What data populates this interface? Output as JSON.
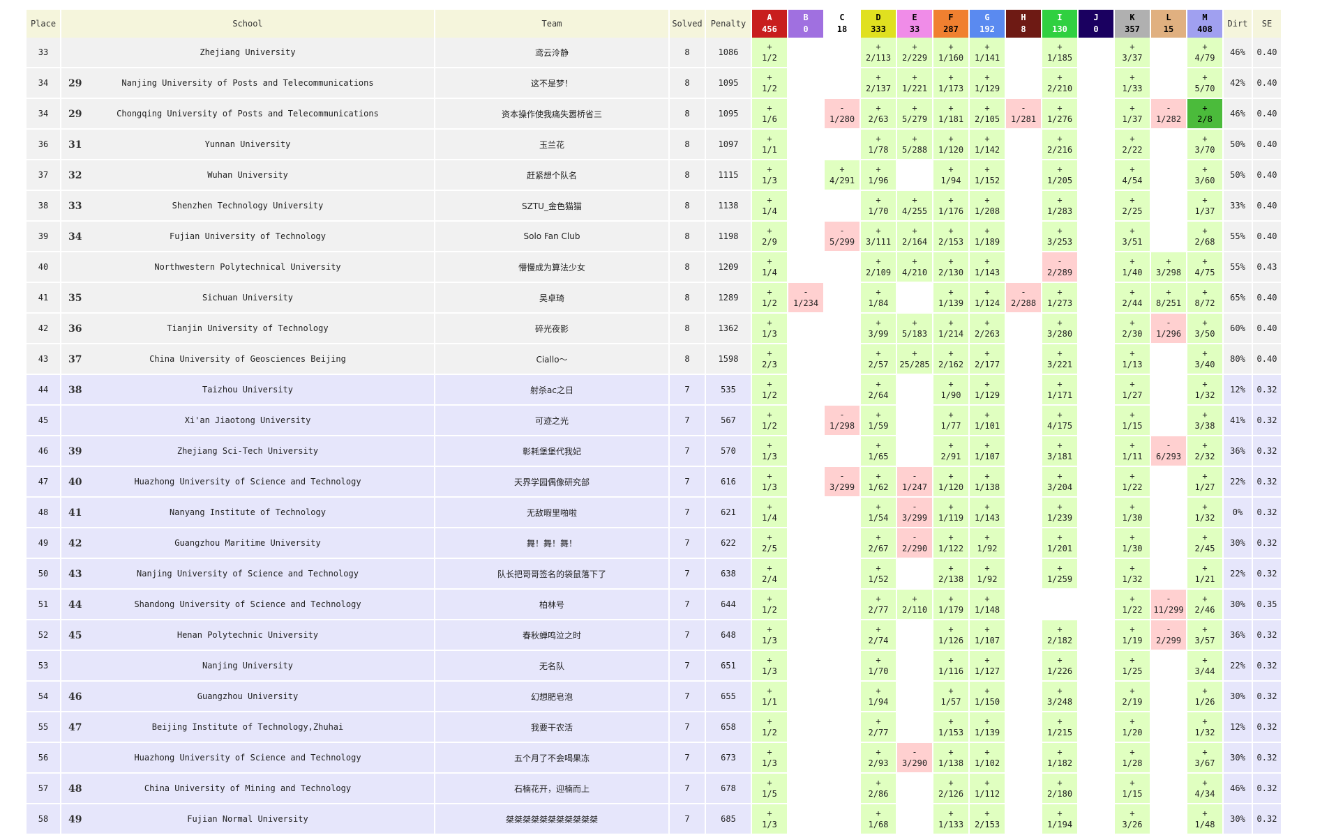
{
  "headers": {
    "place": "Place",
    "school": "School",
    "team": "Team",
    "solved": "Solved",
    "penalty": "Penalty",
    "dirt": "Dirt",
    "se": "SE"
  },
  "problems": [
    {
      "letter": "A",
      "count": "456",
      "bg": "#c81e1e",
      "fg": "#ffffff"
    },
    {
      "letter": "B",
      "count": "0",
      "bg": "#a070e0",
      "fg": "#ffffff"
    },
    {
      "letter": "C",
      "count": "18",
      "bg": "#ffffff",
      "fg": "#000000"
    },
    {
      "letter": "D",
      "count": "333",
      "bg": "#e0e020",
      "fg": "#000000"
    },
    {
      "letter": "E",
      "count": "33",
      "bg": "#f08ce8",
      "fg": "#000000"
    },
    {
      "letter": "F",
      "count": "287",
      "bg": "#f08030",
      "fg": "#000000"
    },
    {
      "letter": "G",
      "count": "192",
      "bg": "#5a8af0",
      "fg": "#ffffff"
    },
    {
      "letter": "H",
      "count": "8",
      "bg": "#6e1a14",
      "fg": "#ffffff"
    },
    {
      "letter": "I",
      "count": "130",
      "bg": "#30d040",
      "fg": "#ffffff"
    },
    {
      "letter": "J",
      "count": "0",
      "bg": "#1a0060",
      "fg": "#ffffff"
    },
    {
      "letter": "K",
      "count": "357",
      "bg": "#b0b0b0",
      "fg": "#000000"
    },
    {
      "letter": "L",
      "count": "15",
      "bg": "#e0b080",
      "fg": "#000000"
    },
    {
      "letter": "M",
      "count": "408",
      "bg": "#a0a0f0",
      "fg": "#000000"
    }
  ],
  "rows": [
    {
      "place": "33",
      "srank": "",
      "school": "Zhejiang University",
      "team": "鸢云泠静",
      "solved": "8",
      "penalty": "1086",
      "dirt": "46%",
      "se": "0.40",
      "group": 8,
      "cells": [
        "+|1/2",
        "",
        "",
        "+|2/113",
        "+|2/229",
        "+|1/160",
        "+|1/141",
        "",
        "+|1/185",
        "",
        "+|3/37",
        "",
        "+|4/79"
      ]
    },
    {
      "place": "34",
      "srank": "29",
      "school": "Nanjing University of Posts and Telecommunications",
      "team": "这不是梦！",
      "solved": "8",
      "penalty": "1095",
      "dirt": "42%",
      "se": "0.40",
      "group": 8,
      "cells": [
        "+|1/2",
        "",
        "",
        "+|2/137",
        "+|1/221",
        "+|1/173",
        "+|1/129",
        "",
        "+|2/210",
        "",
        "+|1/33",
        "",
        "+|5/70"
      ]
    },
    {
      "place": "34",
      "srank": "29",
      "school": "Chongqing University of Posts and Telecommunications",
      "team": "资本操作使我痛失嚣桥省三",
      "solved": "8",
      "penalty": "1095",
      "dirt": "46%",
      "se": "0.40",
      "group": 8,
      "cells": [
        "+|1/6",
        "",
        "-|1/280",
        "+|2/63",
        "+|5/279",
        "+|1/181",
        "+|2/105",
        "-|1/281",
        "+|1/276",
        "",
        "+|1/37",
        "-|1/282",
        "*|2/8"
      ]
    },
    {
      "place": "36",
      "srank": "31",
      "school": "Yunnan University",
      "team": "玉兰花",
      "solved": "8",
      "penalty": "1097",
      "dirt": "50%",
      "se": "0.40",
      "group": 8,
      "cells": [
        "+|1/1",
        "",
        "",
        "+|1/78",
        "+|5/288",
        "+|1/120",
        "+|1/142",
        "",
        "+|2/216",
        "",
        "+|2/22",
        "",
        "+|3/70"
      ]
    },
    {
      "place": "37",
      "srank": "32",
      "school": "Wuhan University",
      "team": "赶紧想个队名",
      "solved": "8",
      "penalty": "1115",
      "dirt": "50%",
      "se": "0.40",
      "group": 8,
      "cells": [
        "+|1/3",
        "",
        "+|4/291",
        "+|1/96",
        "",
        "+|1/94",
        "+|1/152",
        "",
        "+|1/205",
        "",
        "+|4/54",
        "",
        "+|3/60"
      ]
    },
    {
      "place": "38",
      "srank": "33",
      "school": "Shenzhen Technology University",
      "team": "SZTU_金色猫猫",
      "solved": "8",
      "penalty": "1138",
      "dirt": "33%",
      "se": "0.40",
      "group": 8,
      "cells": [
        "+|1/4",
        "",
        "",
        "+|1/70",
        "+|4/255",
        "+|1/176",
        "+|1/208",
        "",
        "+|1/283",
        "",
        "+|2/25",
        "",
        "+|1/37"
      ]
    },
    {
      "place": "39",
      "srank": "34",
      "school": "Fujian University of Technology",
      "team": "Solo Fan Club",
      "solved": "8",
      "penalty": "1198",
      "dirt": "55%",
      "se": "0.40",
      "group": 8,
      "cells": [
        "+|2/9",
        "",
        "-|5/299",
        "+|3/111",
        "+|2/164",
        "+|2/153",
        "+|1/189",
        "",
        "+|3/253",
        "",
        "+|3/51",
        "",
        "+|2/68"
      ]
    },
    {
      "place": "40",
      "srank": "",
      "school": "Northwestern Polytechnical University",
      "team": "懵慢成为算法少女",
      "solved": "8",
      "penalty": "1209",
      "dirt": "55%",
      "se": "0.43",
      "group": 8,
      "cells": [
        "+|1/4",
        "",
        "",
        "+|2/109",
        "+|4/210",
        "+|2/130",
        "+|1/143",
        "",
        "-|2/289",
        "",
        "+|1/40",
        "+|3/298",
        "+|4/75"
      ]
    },
    {
      "place": "41",
      "srank": "35",
      "school": "Sichuan University",
      "team": "吴卓琦",
      "solved": "8",
      "penalty": "1289",
      "dirt": "65%",
      "se": "0.40",
      "group": 8,
      "cells": [
        "+|1/2",
        "-|1/234",
        "",
        "+|1/84",
        "",
        "+|1/139",
        "+|1/124",
        "-|2/288",
        "+|1/273",
        "",
        "+|2/44",
        "+|8/251",
        "+|8/72"
      ]
    },
    {
      "place": "42",
      "srank": "36",
      "school": "Tianjin University of Technology",
      "team": "碎光夜影",
      "solved": "8",
      "penalty": "1362",
      "dirt": "60%",
      "se": "0.40",
      "group": 8,
      "cells": [
        "+|1/3",
        "",
        "",
        "+|3/99",
        "+|5/183",
        "+|1/214",
        "+|2/263",
        "",
        "+|3/280",
        "",
        "+|2/30",
        "-|1/296",
        "+|3/50"
      ]
    },
    {
      "place": "43",
      "srank": "37",
      "school": "China University of Geosciences Beijing",
      "team": "Ciallo～",
      "solved": "8",
      "penalty": "1598",
      "dirt": "80%",
      "se": "0.40",
      "group": 8,
      "cells": [
        "+|2/3",
        "",
        "",
        "+|2/57",
        "+|25/285",
        "+|2/162",
        "+|2/177",
        "",
        "+|3/221",
        "",
        "+|1/13",
        "",
        "+|3/40"
      ]
    },
    {
      "place": "44",
      "srank": "38",
      "school": "Taizhou University",
      "team": "射杀ac之日",
      "solved": "7",
      "penalty": "535",
      "dirt": "12%",
      "se": "0.32",
      "group": 7,
      "cells": [
        "+|1/2",
        "",
        "",
        "+|2/64",
        "",
        "+|1/90",
        "+|1/129",
        "",
        "+|1/171",
        "",
        "+|1/27",
        "",
        "+|1/32"
      ]
    },
    {
      "place": "45",
      "srank": "",
      "school": "Xi'an Jiaotong University",
      "team": "可迹之光",
      "solved": "7",
      "penalty": "567",
      "dirt": "41%",
      "se": "0.32",
      "group": 7,
      "cells": [
        "+|1/2",
        "",
        "-|1/298",
        "+|1/59",
        "",
        "+|1/77",
        "+|1/101",
        "",
        "+|4/175",
        "",
        "+|1/15",
        "",
        "+|3/38"
      ]
    },
    {
      "place": "46",
      "srank": "39",
      "school": "Zhejiang Sci-Tech University",
      "team": "彰耗堡堡代我妃",
      "solved": "7",
      "penalty": "570",
      "dirt": "36%",
      "se": "0.32",
      "group": 7,
      "cells": [
        "+|1/3",
        "",
        "",
        "+|1/65",
        "",
        "+|2/91",
        "+|1/107",
        "",
        "+|3/181",
        "",
        "+|1/11",
        "-|6/293",
        "+|2/32"
      ]
    },
    {
      "place": "47",
      "srank": "40",
      "school": "Huazhong University of Science and Technology",
      "team": "天界学园偶像研究部",
      "solved": "7",
      "penalty": "616",
      "dirt": "22%",
      "se": "0.32",
      "group": 7,
      "cells": [
        "+|1/3",
        "",
        "-|3/299",
        "+|1/62",
        "-|1/247",
        "+|1/120",
        "+|1/138",
        "",
        "+|3/204",
        "",
        "+|1/22",
        "",
        "+|1/27"
      ]
    },
    {
      "place": "48",
      "srank": "41",
      "school": "Nanyang Institute of Technology",
      "team": "无敌暇里啪啦",
      "solved": "7",
      "penalty": "621",
      "dirt": "0%",
      "se": "0.32",
      "group": 7,
      "cells": [
        "+|1/4",
        "",
        "",
        "+|1/54",
        "-|3/299",
        "+|1/119",
        "+|1/143",
        "",
        "+|1/239",
        "",
        "+|1/30",
        "",
        "+|1/32"
      ]
    },
    {
      "place": "49",
      "srank": "42",
      "school": "Guangzhou Maritime University",
      "team": "舞！舞！舞！",
      "solved": "7",
      "penalty": "622",
      "dirt": "30%",
      "se": "0.32",
      "group": 7,
      "cells": [
        "+|2/5",
        "",
        "",
        "+|2/67",
        "-|2/290",
        "+|1/122",
        "+|1/92",
        "",
        "+|1/201",
        "",
        "+|1/30",
        "",
        "+|2/45"
      ]
    },
    {
      "place": "50",
      "srank": "43",
      "school": "Nanjing University of Science and Technology",
      "team": "队长把哥哥签名的袋鼠落下了",
      "solved": "7",
      "penalty": "638",
      "dirt": "22%",
      "se": "0.32",
      "group": 7,
      "cells": [
        "+|2/4",
        "",
        "",
        "+|1/52",
        "",
        "+|2/138",
        "+|1/92",
        "",
        "+|1/259",
        "",
        "+|1/32",
        "",
        "+|1/21"
      ]
    },
    {
      "place": "51",
      "srank": "44",
      "school": "Shandong University of Science and Technology",
      "team": "柏林号",
      "solved": "7",
      "penalty": "644",
      "dirt": "30%",
      "se": "0.35",
      "group": 7,
      "cells": [
        "+|1/2",
        "",
        "",
        "+|2/77",
        "+|2/110",
        "+|1/179",
        "+|1/148",
        "",
        "",
        "",
        "+|1/22",
        "-|11/299",
        "+|2/46"
      ]
    },
    {
      "place": "52",
      "srank": "45",
      "school": "Henan Polytechnic University",
      "team": "春秋蝉鸣泣之时",
      "solved": "7",
      "penalty": "648",
      "dirt": "36%",
      "se": "0.32",
      "group": 7,
      "cells": [
        "+|1/3",
        "",
        "",
        "+|2/74",
        "",
        "+|1/126",
        "+|1/107",
        "",
        "+|2/182",
        "",
        "+|1/19",
        "-|2/299",
        "+|3/57"
      ]
    },
    {
      "place": "53",
      "srank": "",
      "school": "Nanjing University",
      "team": "无名队",
      "solved": "7",
      "penalty": "651",
      "dirt": "22%",
      "se": "0.32",
      "group": 7,
      "cells": [
        "+|1/3",
        "",
        "",
        "+|1/70",
        "",
        "+|1/116",
        "+|1/127",
        "",
        "+|1/226",
        "",
        "+|1/25",
        "",
        "+|3/44"
      ]
    },
    {
      "place": "54",
      "srank": "46",
      "school": "Guangzhou University",
      "team": "幻想肥皂泡",
      "solved": "7",
      "penalty": "655",
      "dirt": "30%",
      "se": "0.32",
      "group": 7,
      "cells": [
        "+|1/1",
        "",
        "",
        "+|1/94",
        "",
        "+|1/57",
        "+|1/150",
        "",
        "+|3/248",
        "",
        "+|2/19",
        "",
        "+|1/26"
      ]
    },
    {
      "place": "55",
      "srank": "47",
      "school": "Beijing Institute of Technology,Zhuhai",
      "team": "我要干农活",
      "solved": "7",
      "penalty": "658",
      "dirt": "12%",
      "se": "0.32",
      "group": 7,
      "cells": [
        "+|1/2",
        "",
        "",
        "+|2/77",
        "",
        "+|1/153",
        "+|1/139",
        "",
        "+|1/215",
        "",
        "+|1/20",
        "",
        "+|1/32"
      ]
    },
    {
      "place": "56",
      "srank": "",
      "school": "Huazhong University of Science and Technology",
      "team": "五个月了不会喝果冻",
      "solved": "7",
      "penalty": "673",
      "dirt": "30%",
      "se": "0.32",
      "group": 7,
      "cells": [
        "+|1/3",
        "",
        "",
        "+|2/93",
        "-|3/290",
        "+|1/138",
        "+|1/102",
        "",
        "+|1/182",
        "",
        "+|1/28",
        "",
        "+|3/67"
      ]
    },
    {
      "place": "57",
      "srank": "48",
      "school": "China University of Mining and Technology",
      "team": "石楠花开，迎楠而上",
      "solved": "7",
      "penalty": "678",
      "dirt": "46%",
      "se": "0.32",
      "group": 7,
      "cells": [
        "+|1/5",
        "",
        "",
        "+|2/86",
        "",
        "+|2/126",
        "+|1/112",
        "",
        "+|2/180",
        "",
        "+|1/15",
        "",
        "+|4/34"
      ]
    },
    {
      "place": "58",
      "srank": "49",
      "school": "Fujian Normal University",
      "team": "桀桀桀桀桀桀桀桀桀桀桀",
      "solved": "7",
      "penalty": "685",
      "dirt": "30%",
      "se": "0.32",
      "group": 7,
      "cells": [
        "+|1/3",
        "",
        "",
        "+|1/68",
        "",
        "+|1/133",
        "+|2/153",
        "",
        "+|1/194",
        "",
        "+|3/26",
        "",
        "+|1/48"
      ]
    }
  ]
}
